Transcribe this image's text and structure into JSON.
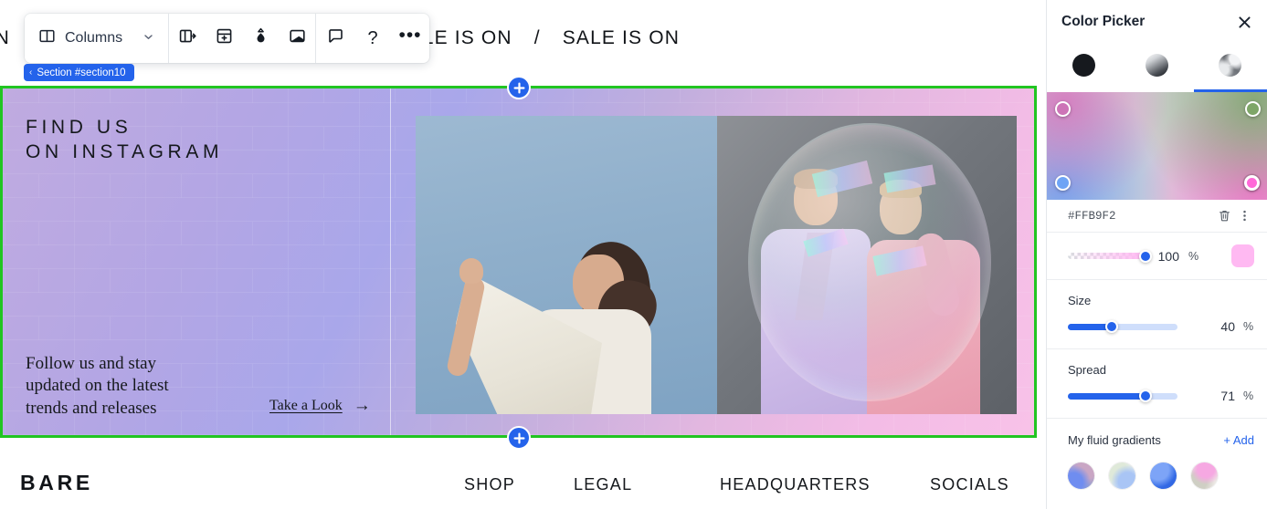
{
  "toolbar": {
    "columns_label": "Columns",
    "columns_icon": "columns-layout-icon",
    "chevron_icon": "chevron-down-icon",
    "buttons": [
      {
        "name": "duplicate-section-button",
        "icon": "panel-arrow-right-icon"
      },
      {
        "name": "save-section-button",
        "icon": "floppy-plus-icon"
      },
      {
        "name": "eyedropper-button",
        "icon": "ink-drop-icon"
      },
      {
        "name": "background-button",
        "icon": "image-fill-icon"
      },
      {
        "name": "comment-button",
        "icon": "speech-bubble-icon"
      },
      {
        "name": "help-button",
        "icon": "question-mark-icon",
        "glyph": "?"
      },
      {
        "name": "more-options-button",
        "icon": "ellipsis-icon",
        "glyph": "•••"
      }
    ]
  },
  "section_badge": {
    "chevron": "‹",
    "label": "Section #section10"
  },
  "canvas": {
    "marquee": {
      "leading_partial": "IS ON",
      "text": "SALE IS ON",
      "separator": "/",
      "repeat_count": 4
    },
    "section": {
      "heading_line1": "FIND US",
      "heading_line2": "ON INSTAGRAM",
      "subcopy_line1": "Follow us and stay",
      "subcopy_line2": "updated on the latest",
      "subcopy_line3": "trends and releases",
      "cta_label": "Take a Look",
      "cta_arrow": "→",
      "photo_a_alt": "woman holding white fabric against blue sky",
      "photo_b_alt": "two models in pastel suits inside a soap bubble"
    },
    "add_button_glyph": "+",
    "footer": {
      "brand": "BARE",
      "columns": [
        "SHOP",
        "LEGAL",
        "HEADQUARTERS",
        "SOCIALS"
      ]
    }
  },
  "panel": {
    "title": "Color Picker",
    "close_icon": "close-icon",
    "modes": [
      {
        "name": "solid-color-mode",
        "label": "Solid",
        "active": false
      },
      {
        "name": "linear-gradient-mode",
        "label": "Linear gradient",
        "active": false
      },
      {
        "name": "fluid-gradient-mode",
        "label": "Fluid gradient",
        "active": true
      }
    ],
    "mesh_points": [
      {
        "name": "mesh-point-top-left",
        "color": "#CD74B7"
      },
      {
        "name": "mesh-point-top-right",
        "color": "#7EA668"
      },
      {
        "name": "mesh-point-bottom-left",
        "color": "#6EA4F5"
      },
      {
        "name": "mesh-point-bottom-right",
        "color": "#FF68D8",
        "selected": true
      }
    ],
    "hex_value": "#FFB9F2",
    "delete_icon": "trash-icon",
    "more_icon": "kebab-menu-icon",
    "opacity": {
      "value": "100",
      "unit": "%",
      "preview_color": "#FFB9F2"
    },
    "size": {
      "label": "Size",
      "value": "40",
      "unit": "%"
    },
    "spread": {
      "label": "Spread",
      "value": "71",
      "unit": "%"
    },
    "fluid_gradients": {
      "title": "My fluid gradients",
      "add_label": "+ Add",
      "swatches": [
        "violet-blue",
        "pale-green-blue",
        "blue",
        "pink-cream"
      ]
    }
  },
  "colors": {
    "accent_blue": "#2463EB",
    "selection_green": "#21C521",
    "panel_border": "#E4E7EB"
  }
}
